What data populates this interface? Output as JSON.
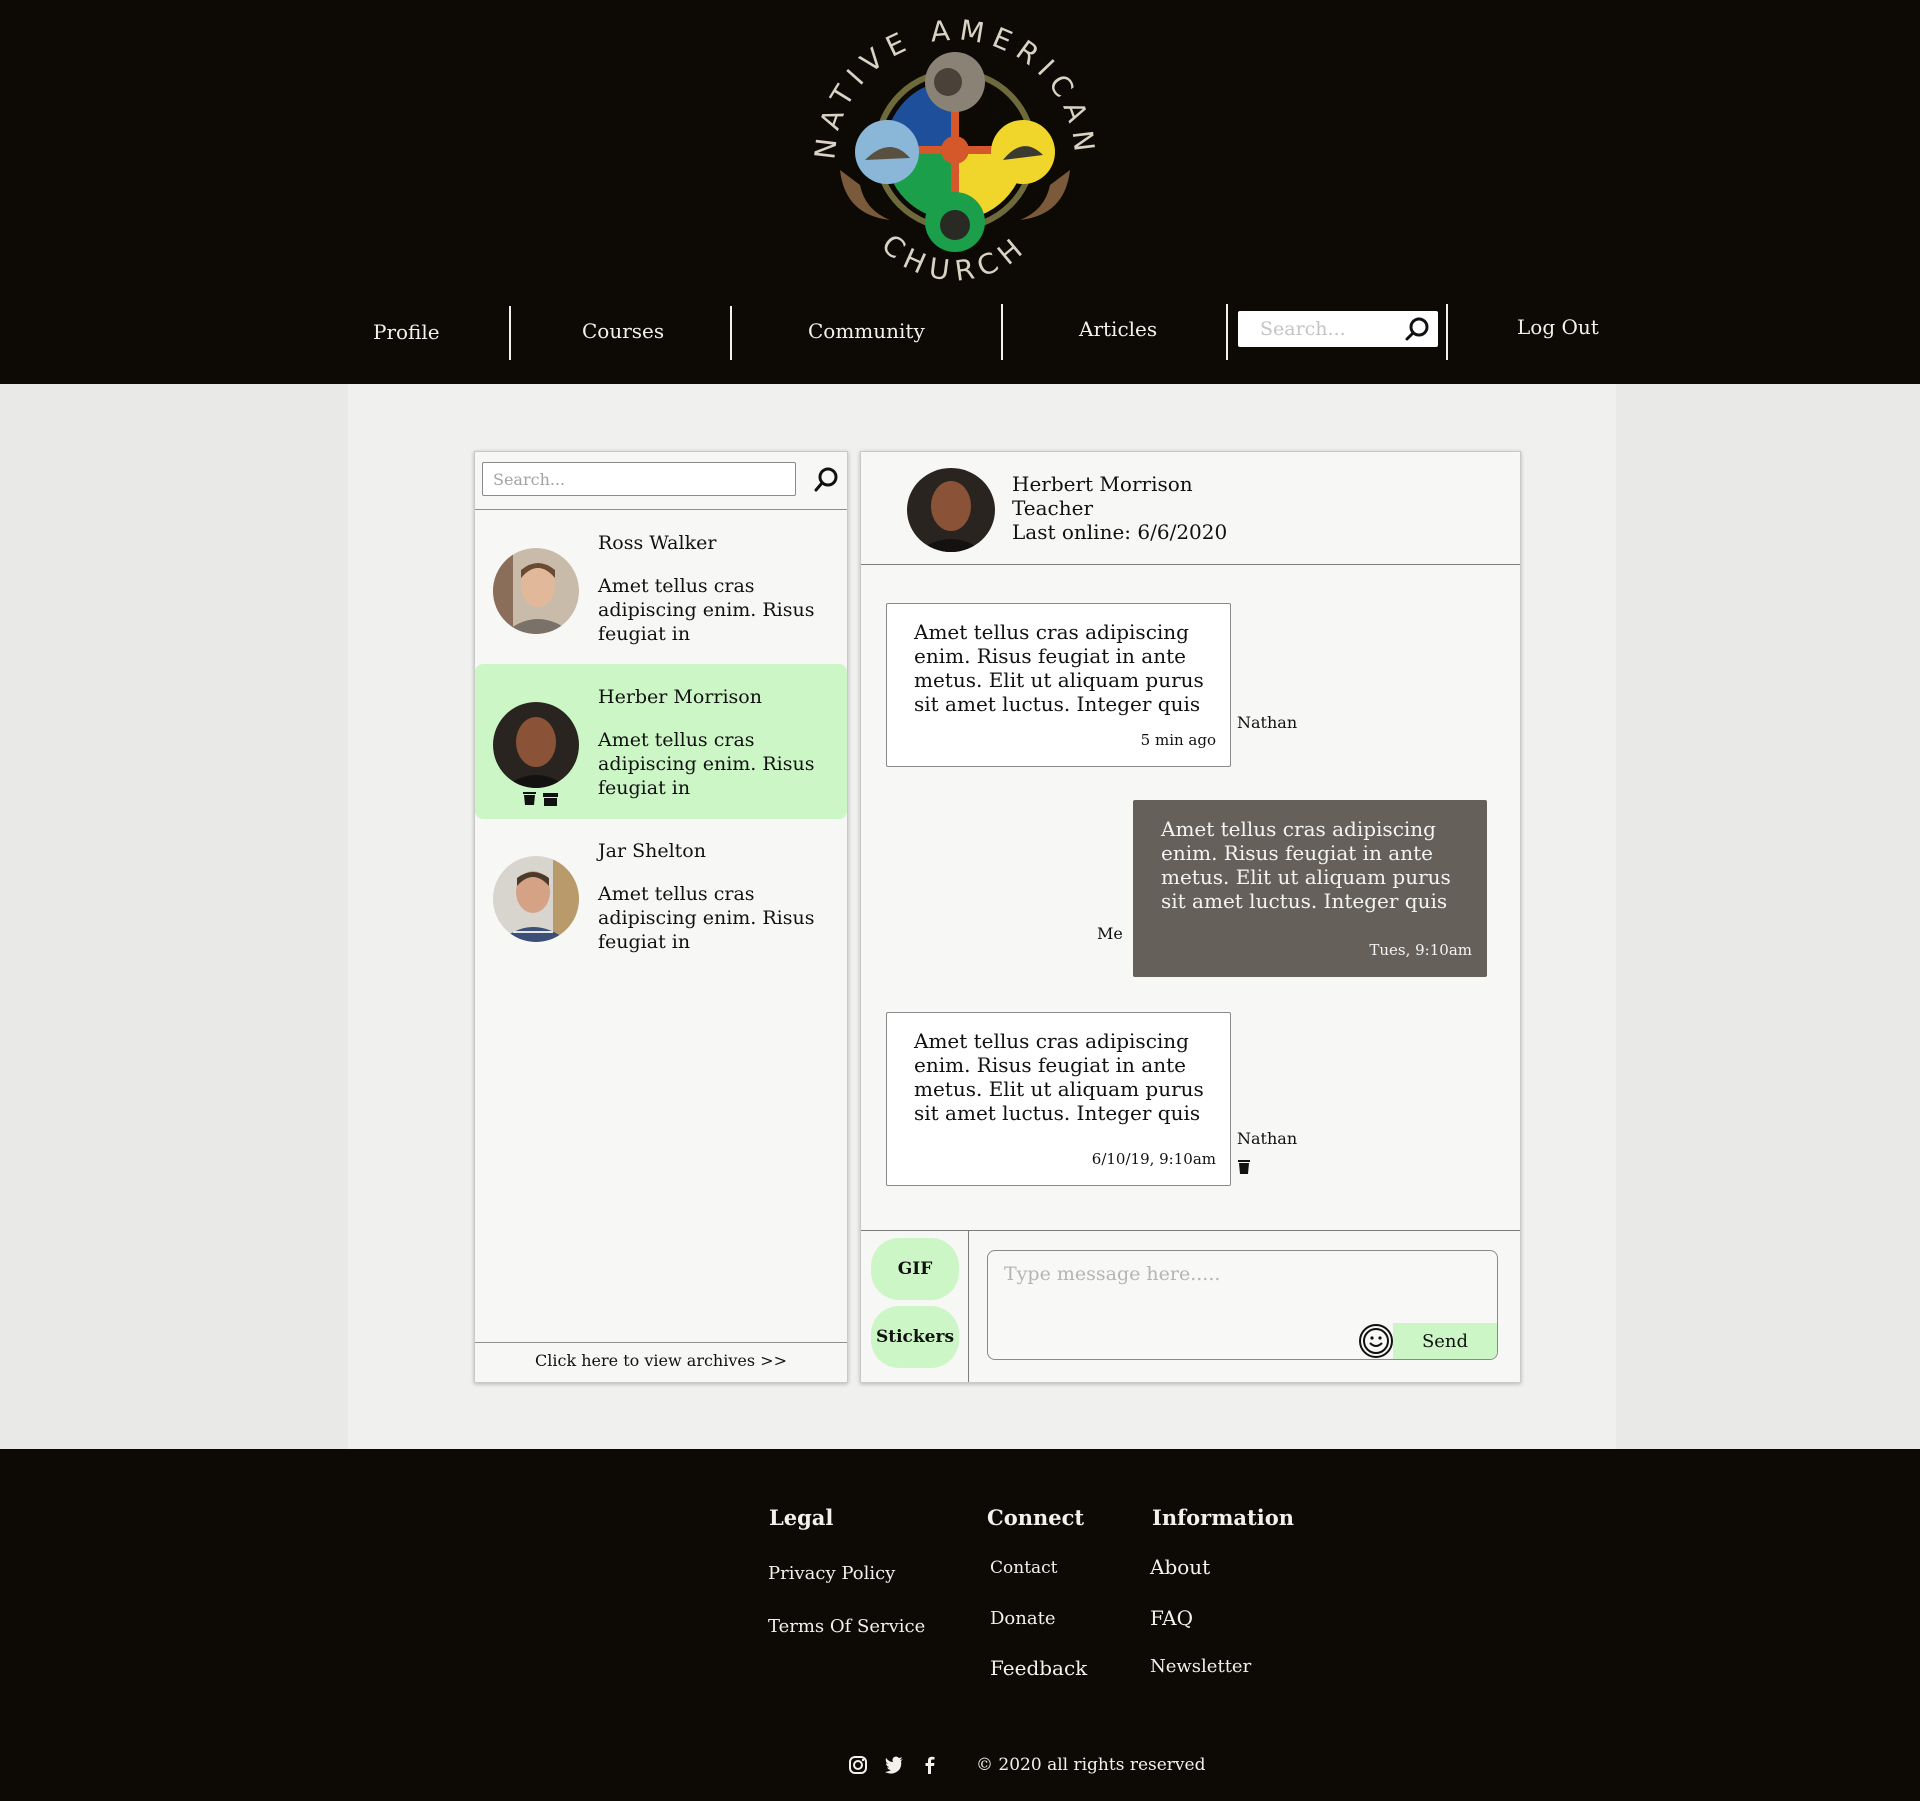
{
  "header": {
    "logo_text_top": "NATIVE AMERICAN",
    "logo_text_bottom": "CHURCH",
    "nav": [
      "Profile",
      "Courses",
      "Community",
      "Articles"
    ],
    "search_placeholder": "Search...",
    "logout": "Log Out"
  },
  "messenger": {
    "search_placeholder": "Search...",
    "contacts": [
      {
        "name": "Ross Walker",
        "preview": "Amet tellus cras adipiscing enim. Risus feugiat in"
      },
      {
        "name": "Herber Morrison",
        "preview": "Amet tellus cras adipiscing enim. Risus feugiat in",
        "active": true
      },
      {
        "name": "Jar Shelton",
        "preview": "Amet tellus cras adipiscing enim. Risus feugiat in"
      }
    ],
    "archives_link": "Click here to view archives >>"
  },
  "chat": {
    "name": "Herbert Morrison",
    "role": "Teacher",
    "last_online": "Last online: 6/6/2020",
    "messages": [
      {
        "text": "Amet tellus cras adipiscing enim. Risus feugiat in ante metus. Elit ut aliquam purus sit amet luctus. Integer quis",
        "time": "5 min ago",
        "sender": "Nathan",
        "direction": "in"
      },
      {
        "text": "Amet tellus cras adipiscing enim. Risus feugiat in ante metus. Elit ut aliquam purus sit amet luctus. Integer quis",
        "time": "Tues, 9:10am",
        "sender": "Me",
        "direction": "out"
      },
      {
        "text": "Amet tellus cras adipiscing enim. Risus feugiat in ante metus. Elit ut aliquam purus sit amet luctus. Integer quis",
        "time": "6/10/19, 9:10am",
        "sender": "Nathan",
        "direction": "in"
      }
    ],
    "gif_label": "GIF",
    "stickers_label": "Stickers",
    "compose_placeholder": "Type message here.....",
    "send_label": "Send"
  },
  "footer": {
    "legal": {
      "heading": "Legal",
      "links": [
        "Privacy Policy",
        "Terms Of Service"
      ]
    },
    "connect": {
      "heading": "Connect",
      "links": [
        "Contact",
        "Donate",
        "Feedback"
      ]
    },
    "information": {
      "heading": "Information",
      "links": [
        "About",
        "FAQ",
        "Newsletter"
      ]
    },
    "social_icons": [
      "instagram-icon",
      "twitter-icon",
      "facebook-icon"
    ],
    "copyright": "© 2020 all rights reserved"
  },
  "colors": {
    "header_bg": "#0d0904",
    "accent_green": "#cdf6c7",
    "outgoing_bubble": "#656059",
    "page_bg": "#e9e9e7"
  }
}
